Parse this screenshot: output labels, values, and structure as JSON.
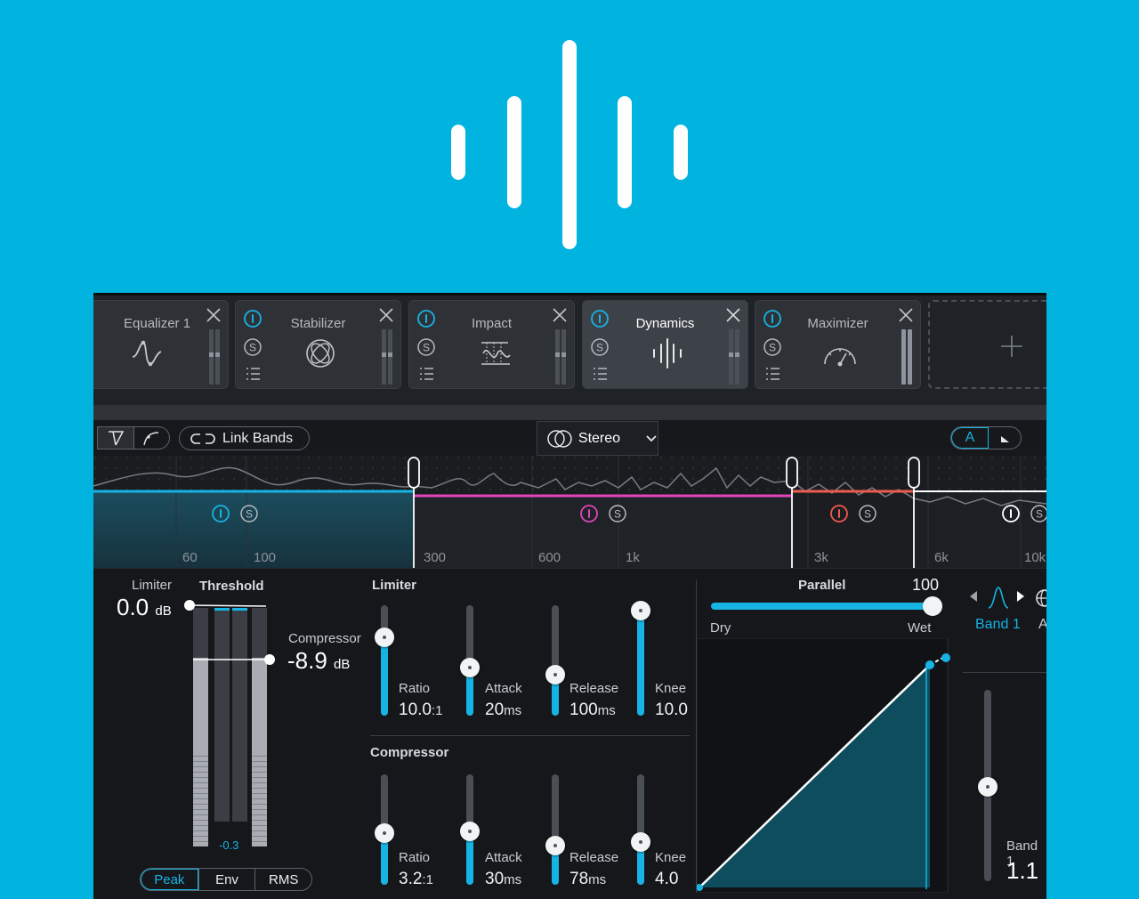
{
  "modules": [
    {
      "name": "Equalizer 1",
      "icon": "eq-curve-icon"
    },
    {
      "name": "Stabilizer",
      "icon": "stabilizer-icon"
    },
    {
      "name": "Impact",
      "icon": "impact-icon"
    },
    {
      "name": "Dynamics",
      "icon": "dynamics-icon",
      "active": true
    },
    {
      "name": "Maximizer",
      "icon": "maximizer-gauge-icon"
    }
  ],
  "toolbar": {
    "link_bands": "Link Bands",
    "stereo": "Stereo",
    "a_label": "A"
  },
  "spectrum": {
    "freq_labels": [
      "60",
      "100",
      "300",
      "600",
      "1k",
      "3k",
      "6k",
      "10k"
    ],
    "band_colors": [
      "#17b3e3",
      "#e046b9",
      "#ef5a4f",
      "#ffffff"
    ]
  },
  "meters": {
    "limiter_label": "Limiter",
    "limiter_value": "0.0",
    "limiter_unit": "dB",
    "threshold_label": "Threshold",
    "compressor_label": "Compressor",
    "compressor_value": "-8.9",
    "compressor_unit": "dB",
    "gr_readout": "-0.3",
    "modes": [
      "Peak",
      "Env",
      "RMS"
    ],
    "mode_selected": "Peak"
  },
  "limiter": {
    "title": "Limiter",
    "ratio_label": "Ratio",
    "ratio_value": "10.0",
    "ratio_unit": ":1",
    "attack_label": "Attack",
    "attack_value": "20",
    "attack_unit": "ms",
    "release_label": "Release",
    "release_value": "100",
    "release_unit": "ms",
    "knee_label": "Knee",
    "knee_value": "10.0"
  },
  "compressor": {
    "title": "Compressor",
    "ratio_label": "Ratio",
    "ratio_value": "3.2",
    "ratio_unit": ":1",
    "attack_label": "Attack",
    "attack_value": "30",
    "attack_unit": "ms",
    "release_label": "Release",
    "release_value": "78",
    "release_unit": "ms",
    "knee_label": "Knee",
    "knee_value": "4.0"
  },
  "parallel": {
    "title": "Parallel",
    "value": "100",
    "dry_label": "Dry",
    "wet_label": "Wet"
  },
  "band": {
    "name": "Band 1",
    "partial_label": "A",
    "gain_label": "Band 1",
    "gain_value": "1.1"
  },
  "colors": {
    "accent": "#17b3e3",
    "background": "#01b4e0"
  }
}
